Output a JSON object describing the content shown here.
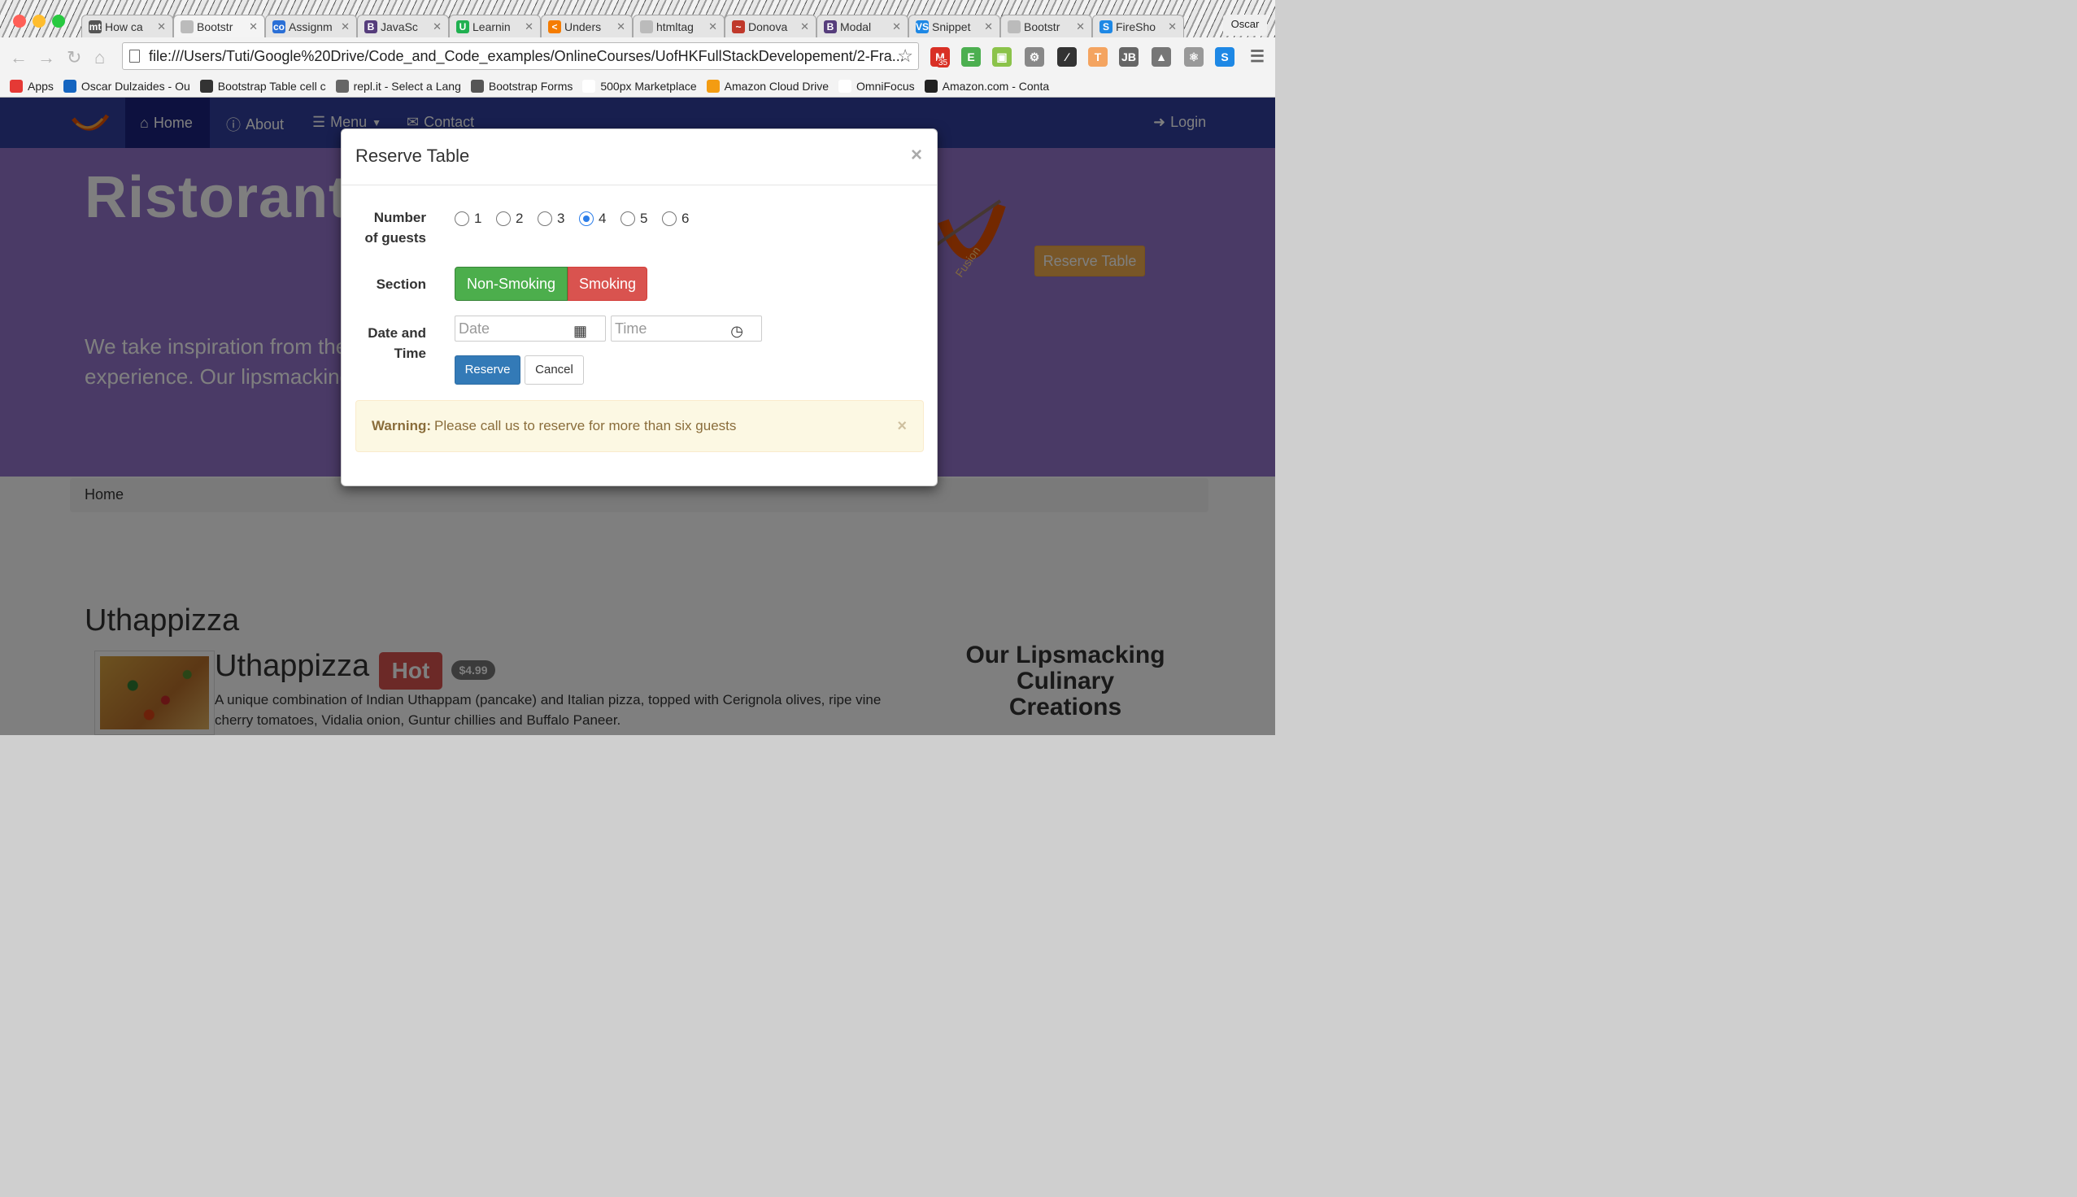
{
  "browser": {
    "tabs": [
      {
        "icon": "mt",
        "label": "How ca",
        "color": "#555555"
      },
      {
        "icon": "",
        "label": "Bootstr",
        "color": "#bbbbbb"
      },
      {
        "icon": "co",
        "label": "Assignm",
        "color": "#2a6fd6"
      },
      {
        "icon": "B",
        "label": "JavaSc",
        "color": "#563d7c"
      },
      {
        "icon": "U",
        "label": "Learnin",
        "color": "#20b050"
      },
      {
        "icon": "<",
        "label": "Unders",
        "color": "#f57c00"
      },
      {
        "icon": "",
        "label": "htmltag",
        "color": "#bbbbbb"
      },
      {
        "icon": "~",
        "label": "Donova",
        "color": "#c0392b"
      },
      {
        "icon": "B",
        "label": "Modal",
        "color": "#563d7c"
      },
      {
        "icon": "VS",
        "label": "Snippet",
        "color": "#1e88e5"
      },
      {
        "icon": "",
        "label": "Bootstr",
        "color": "#bbbbbb"
      },
      {
        "icon": "S",
        "label": "FireSho",
        "color": "#1e88e5"
      }
    ],
    "active_tab_index": 1,
    "profile": "Oscar",
    "url": "file:///Users/Tuti/Google%20Drive/Code_and_Code_examples/OnlineCourses/UofHKFullStackDevelopement/2-Fra...",
    "mail_badge": "35",
    "bookmarks": [
      {
        "icon": "apps-icon",
        "label": "Apps",
        "color": "#e53935"
      },
      {
        "icon": "outlook-icon",
        "label": "Oscar Dulzaides - Ou",
        "color": "#1565c0"
      },
      {
        "icon": "bootstrap-table-icon",
        "label": "Bootstrap Table cell c",
        "color": "#333333"
      },
      {
        "icon": "replit-icon",
        "label": "repl.it - Select a Lang",
        "color": "#666666"
      },
      {
        "icon": "bootstrap-forms-icon",
        "label": "Bootstrap Forms",
        "color": "#555555"
      },
      {
        "icon": "500px-icon",
        "label": "500px Marketplace",
        "color": "#ffffff"
      },
      {
        "icon": "amazon-icon",
        "label": "Amazon Cloud Drive",
        "color": "#f39c12"
      },
      {
        "icon": "omnifocus-icon",
        "label": "OmniFocus",
        "color": "#ffffff"
      },
      {
        "icon": "amazon-icon",
        "label": "Amazon.com - Conta",
        "color": "#222222"
      }
    ]
  },
  "site": {
    "nav": {
      "home": "Home",
      "about": "About",
      "menu": "Menu",
      "contact": "Contact",
      "login": "Login"
    },
    "jumbotron": {
      "title": "Ristorante",
      "text": "We take inspiration from the experience. Our lipsmacking",
      "reserve_button": "Reserve Table",
      "logo_text": "Fusion"
    },
    "breadcrumb": "Home",
    "section_title": "Uthappizza",
    "dish": {
      "name": "Uthappizza",
      "badge": "Hot",
      "price": "$4.99",
      "description": "A unique combination of Indian Uthappam (pancake) and Italian pizza, topped with Cerignola olives, ripe vine cherry tomatoes, Vidalia onion, Guntur chillies and Buffalo Paneer."
    },
    "side_heading": "Our Lipsmacking Culinary Creations"
  },
  "modal": {
    "title": "Reserve Table",
    "close": "×",
    "guests_label": "Number of guests",
    "guest_options": [
      "1",
      "2",
      "3",
      "4",
      "5",
      "6"
    ],
    "guests_selected": "4",
    "section_label": "Section",
    "section_options": {
      "non_smoking": "Non-Smoking",
      "smoking": "Smoking"
    },
    "datetime_label": "Date and Time",
    "date_placeholder": "Date",
    "time_placeholder": "Time",
    "reserve_button": "Reserve",
    "cancel_button": "Cancel",
    "alert": {
      "strong": "Warning:",
      "text": "Please call us to reserve for more than six guests",
      "close": "×"
    }
  },
  "colors": {
    "navbar": "#303f9f",
    "navbar_active": "#1a237e",
    "jumbotron": "#9575cd",
    "success": "#4cae4c",
    "danger": "#d9534f",
    "primary": "#337ab7",
    "warning": "#f0ad4e"
  }
}
